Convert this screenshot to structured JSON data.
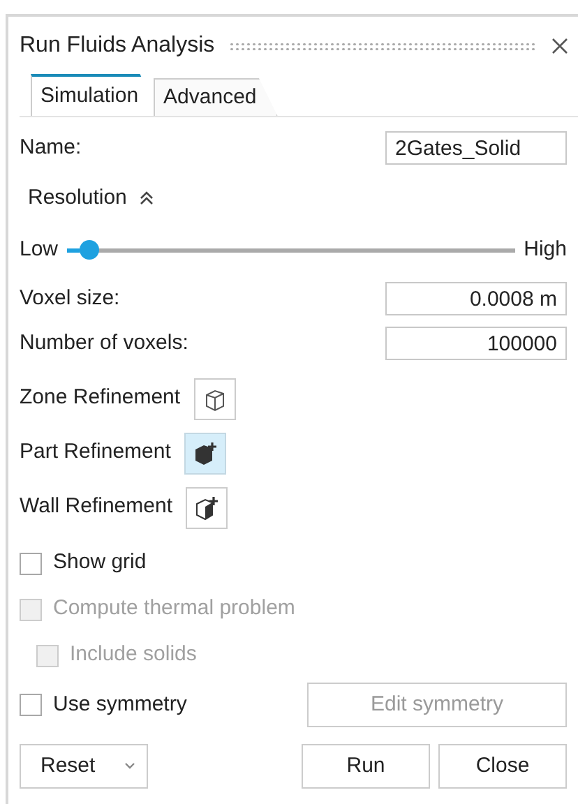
{
  "window": {
    "title": "Run Fluids Analysis"
  },
  "tabs": [
    {
      "label": "Simulation",
      "selected": true
    },
    {
      "label": "Advanced",
      "selected": false
    }
  ],
  "name_field": {
    "label": "Name:",
    "value": "2Gates_Solid"
  },
  "resolution": {
    "label": "Resolution",
    "expanded": true,
    "slider": {
      "low_label": "Low",
      "high_label": "High",
      "level": 0.03
    }
  },
  "fields": [
    {
      "label": "Voxel size:",
      "value": "0.0008 m"
    },
    {
      "label": "Number of voxels:",
      "value": "100000"
    }
  ],
  "refinements": [
    {
      "label": "Zone Refinement",
      "kind": "wireframe",
      "selected": false
    },
    {
      "label": "Part Refinement",
      "kind": "solid",
      "selected": true
    },
    {
      "label": "Wall Refinement",
      "kind": "wall",
      "selected": false
    }
  ],
  "options": [
    {
      "label": "Show grid",
      "checked": false,
      "disabled": false
    },
    {
      "label": "Compute thermal problem",
      "checked": false,
      "disabled": true,
      "children": [
        {
          "label": "Include solids",
          "checked": false,
          "disabled": true
        }
      ]
    }
  ],
  "symmetry": {
    "label": "Use symmetry",
    "checked": false,
    "disabled": false,
    "button": {
      "label": "Edit symmetry",
      "disabled": true
    }
  },
  "footer": {
    "reset": {
      "label": "Reset"
    },
    "run": {
      "label": "Run"
    },
    "close": {
      "label": "Close"
    }
  }
}
